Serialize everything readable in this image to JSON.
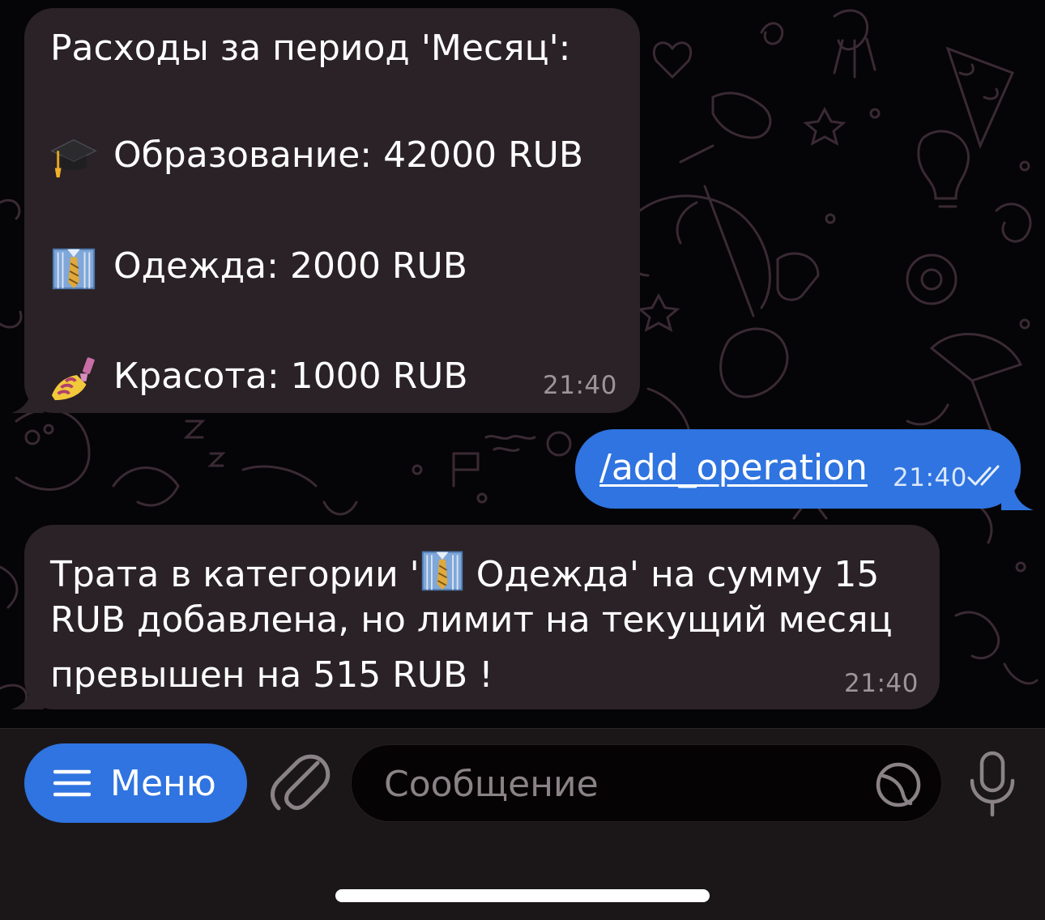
{
  "messages": [
    {
      "direction": "incoming",
      "header": "Расходы за период 'Месяц':",
      "items": [
        {
          "icon": "graduation-cap-emoji",
          "text": "Образование: 42000 RUB"
        },
        {
          "icon": "shirt-tie-emoji",
          "text": "Одежда: 2000 RUB"
        },
        {
          "icon": "nail-polish-emoji",
          "text": "Красота: 1000 RUB"
        }
      ],
      "time": "21:40"
    },
    {
      "direction": "outgoing",
      "text": "/add_operation",
      "time": "21:40",
      "status": "read"
    },
    {
      "direction": "incoming",
      "line1_before": "Трата в категории '",
      "line1_emoji": "shirt-tie-emoji",
      "line1_after": " Одежда' на сумму 15",
      "line2": "RUB добавлена, но лимит на текущий месяц",
      "line3": "превышен на 515 RUB !",
      "time": "21:40"
    }
  ],
  "input_bar": {
    "menu_label": "Меню",
    "placeholder": "Сообщение"
  },
  "colors": {
    "incoming_bubble": "#2a2226",
    "outgoing_bubble": "#2f74e0",
    "accent": "#2f74e0"
  }
}
